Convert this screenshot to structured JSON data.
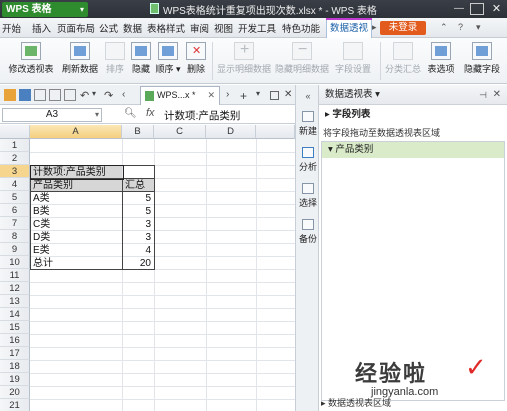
{
  "titlebar": {
    "app_name": "WPS 表格",
    "document_title": "WPS表格统计重复项出现次数.xlsx * - WPS 表格"
  },
  "menu": {
    "items": [
      "开始",
      "插入",
      "页面布局",
      "公式",
      "数据",
      "表格样式",
      "审阅",
      "视图",
      "开发工具",
      "特色功能"
    ],
    "active": "数据透视",
    "login": "未登录"
  },
  "ribbon": {
    "buttons": [
      {
        "label": "修改透视表",
        "icon": "pivot-edit-icon",
        "enabled": true
      },
      {
        "label": "刷新数据",
        "icon": "refresh-icon",
        "enabled": true
      },
      {
        "label": "排序",
        "icon": "sort-icon",
        "enabled": false
      },
      {
        "label": "隐藏",
        "icon": "hide-icon",
        "enabled": true
      },
      {
        "label": "顺序 ▾",
        "icon": "order-icon",
        "enabled": true
      },
      {
        "label": "删除",
        "icon": "delete-icon",
        "enabled": true
      },
      {
        "label": "显示明细数据",
        "icon": "show-detail-icon",
        "enabled": false
      },
      {
        "label": "隐藏明细数据",
        "icon": "hide-detail-icon",
        "enabled": false
      },
      {
        "label": "字段设置",
        "icon": "field-settings-icon",
        "enabled": false
      },
      {
        "label": "分类汇总",
        "icon": "subtotal-icon",
        "enabled": false
      },
      {
        "label": "表选项",
        "icon": "table-options-icon",
        "enabled": true
      },
      {
        "label": "隐藏字段",
        "icon": "hide-field-icon",
        "enabled": true
      }
    ]
  },
  "doc_tab": {
    "label": "WPS...x *"
  },
  "formula_bar": {
    "cell_ref": "A3",
    "fx": "fx",
    "value": "计数项:产品类别"
  },
  "grid": {
    "columns": [
      "A",
      "B",
      "C",
      "D"
    ],
    "rows": [
      "1",
      "2",
      "3",
      "4",
      "5",
      "6",
      "7",
      "8",
      "9",
      "10",
      "11",
      "12",
      "13",
      "14",
      "15",
      "16",
      "17",
      "18",
      "19",
      "20",
      "21"
    ],
    "cells": {
      "r3a": "计数项:产品类别",
      "r4a": "产品类别",
      "r4b": "汇总",
      "r5a": "A类",
      "r5b": "5",
      "r6a": "B类",
      "r6b": "5",
      "r7a": "C类",
      "r7b": "3",
      "r8a": "D类",
      "r8b": "3",
      "r9a": "E类",
      "r9b": "4",
      "r10a": "总计",
      "r10b": "20"
    }
  },
  "side_strip": {
    "items": [
      "新建",
      "分析",
      "选择",
      "备份"
    ]
  },
  "pivot_pane": {
    "title": "数据透视表 ▾",
    "field_list": "字段列表",
    "hint": "将字段拖动至数据透视表区域",
    "fields": [
      "产品类别"
    ],
    "footer": "数据透视表区域"
  },
  "watermark": {
    "big": "经验啦",
    "small": "jingyanla.com"
  }
}
